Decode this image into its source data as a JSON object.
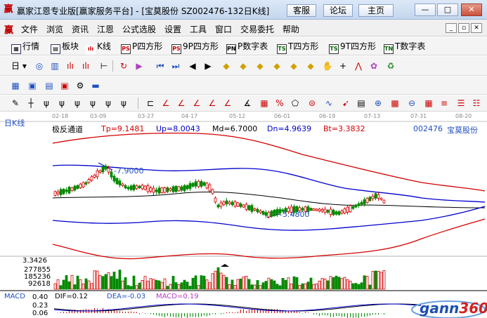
{
  "window": {
    "title": "赢家江恩专业版[赢家服务平台] - [宝莫股份  SZ002476-132日K线]",
    "buttons": [
      "客服",
      "论坛",
      "主页"
    ]
  },
  "menu": [
    "文件",
    "浏览",
    "资讯",
    "江恩",
    "公式选股",
    "设置",
    "工具",
    "窗口",
    "交易委托",
    "帮助"
  ],
  "toolbar1": [
    {
      "label": "行情",
      "icon": "grid-icon"
    },
    {
      "label": "板块",
      "icon": "blocks-icon"
    },
    {
      "label": "K线",
      "icon": "candlestick-icon"
    },
    {
      "label": "P四方形",
      "icon": "PS"
    },
    {
      "label": "9P四方形",
      "icon": "PS"
    },
    {
      "label": "P数字表",
      "icon": "PN"
    },
    {
      "label": "T四方形",
      "icon": "TS"
    },
    {
      "label": "9T四方形",
      "icon": "TS"
    },
    {
      "label": "T数字表",
      "icon": "TN"
    }
  ],
  "toolbar2": {
    "period_label": "日"
  },
  "date_axis": [
    "02-18",
    "03-09",
    "03-27",
    "04-17",
    "05-12",
    "06-01",
    "06-19",
    "07-13",
    "07-31",
    "08-20"
  ],
  "chart": {
    "period": "日K线",
    "indicator": "极反通道",
    "params": [
      {
        "name": "Tp",
        "value": "9.1481",
        "color": "#d40000"
      },
      {
        "name": "Up",
        "value": "8.0043",
        "color": "#0000cc"
      },
      {
        "name": "Md",
        "value": "6.7000",
        "color": "#000000"
      },
      {
        "name": "Dn",
        "value": "4.9639",
        "color": "#0000cc"
      },
      {
        "name": "Bt",
        "value": "3.3832",
        "color": "#d40000"
      }
    ],
    "code": "002476",
    "name": "宝莫股份",
    "high_label": "7.9000",
    "low_label": "5.4800",
    "sub_low_label": "3.3426"
  },
  "volume": {
    "ticks": [
      "277855",
      "185236",
      "92618"
    ]
  },
  "macd": {
    "title": "MACD",
    "dif": "DIF=0.12",
    "dea": "DEA=-0.03",
    "macd": "MACD=0.19",
    "ticks": [
      "0.40",
      "0.23",
      "0.06"
    ]
  },
  "watermark": {
    "text_blue": "gann",
    "text_red": "360"
  },
  "colors": {
    "up": "#d40000",
    "down": "#008a00",
    "outer": "#d40000",
    "inner": "#0000cc",
    "mid": "#000000"
  }
}
